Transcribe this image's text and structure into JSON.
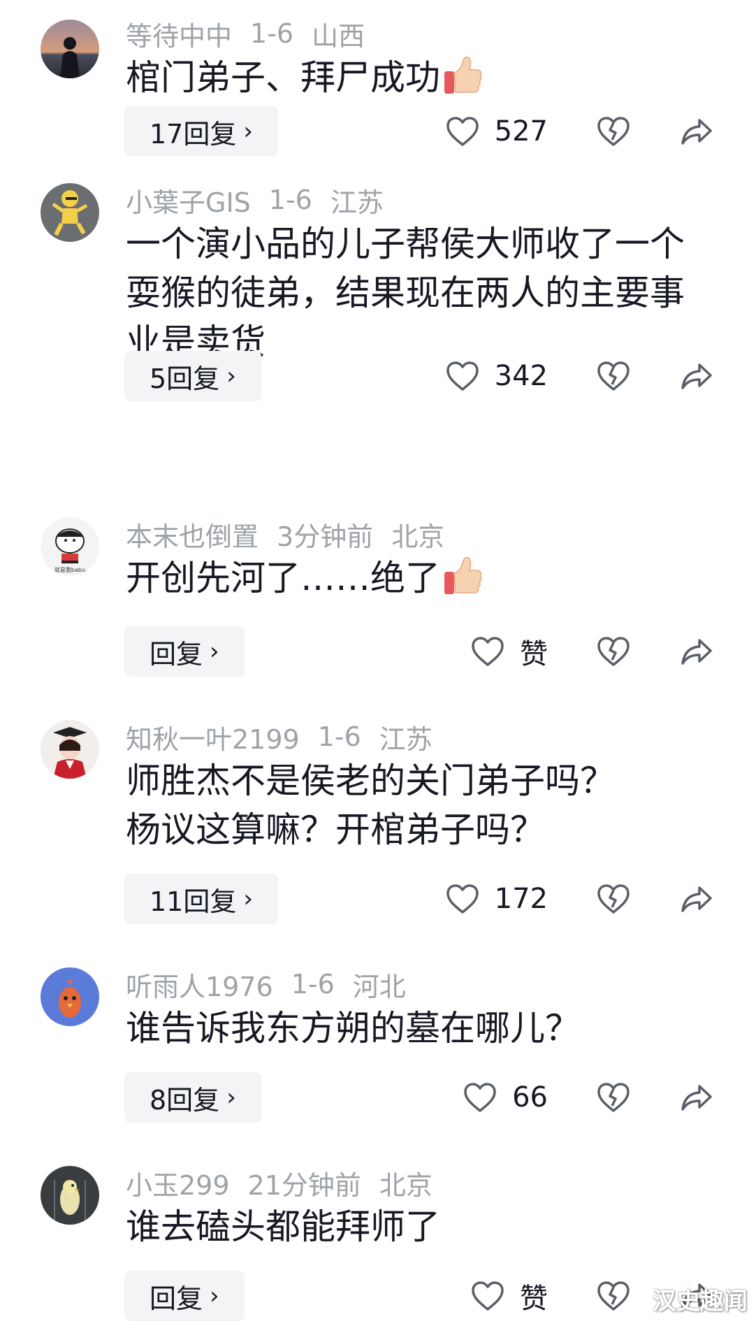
{
  "comments": [
    {
      "username": "等待中中",
      "date": "1-6",
      "location": "山西",
      "text": "棺门弟子、拜尸成功",
      "reply_label": "17回复",
      "likes": "527",
      "avatar_icon": "avatar-silhouette-sunset-icon"
    },
    {
      "username": "小葉子GIS",
      "date": "1-6",
      "location": "江苏",
      "text": "一个演小品的儿子帮侯大师收了一个耍猴的徒弟，结果现在两人的主要事业是卖货",
      "reply_label": "5回复",
      "likes": "342",
      "avatar_icon": "avatar-cartoon-dancer-icon"
    },
    {
      "username": "本末也倒置",
      "date": "3分钟前",
      "location": "北京",
      "text": "开创先河了……绝了",
      "reply_label": "回复",
      "likes": "赞",
      "avatar_icon": "avatar-cartoon-boy-icon",
      "avatar_text": "就是我babu"
    },
    {
      "username": "知秋一叶2199",
      "date": "1-6",
      "location": "江苏",
      "text": "师胜杰不是侯老的关门弟子吗？杨议这算嘛？开棺弟子吗？",
      "reply_label": "11回复",
      "likes": "172",
      "avatar_icon": "avatar-graduate-girl-icon"
    },
    {
      "username": "听雨人1976",
      "date": "1-6",
      "location": "河北",
      "text": "谁告诉我东方朔的墓在哪儿？",
      "reply_label": "8回复",
      "likes": "66",
      "avatar_icon": "avatar-bird-icon"
    },
    {
      "username": "小玉299",
      "date": "21分钟前",
      "location": "北京",
      "text": "谁去磕头都能拜师了",
      "reply_label": "回复",
      "likes": "赞",
      "avatar_icon": "avatar-parrot-icon"
    }
  ],
  "watermark": "汉史趣闻",
  "colors": {
    "text": "#161823",
    "meta": "#9ea3a8",
    "pill_bg": "#f3f4f5"
  }
}
